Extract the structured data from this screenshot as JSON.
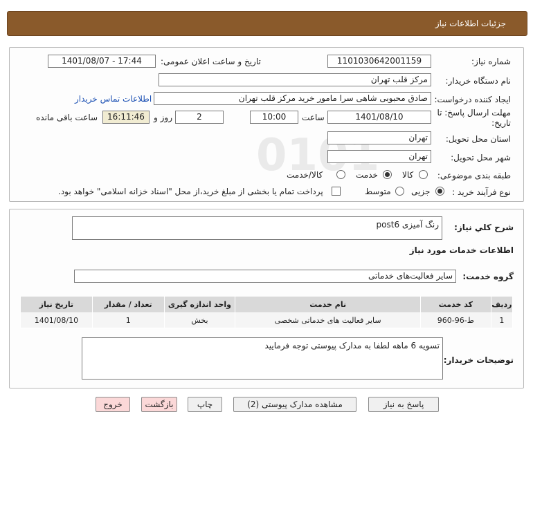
{
  "header": {
    "title": "جزئیات اطلاعات نیاز"
  },
  "form": {
    "need_number_label": "شماره نیاز:",
    "need_number": "1101030642001159",
    "announce_label": "تاریخ و ساعت اعلان عمومی:",
    "announce_value": "1401/08/07 - 17:44",
    "buyer_org_label": "نام دستگاه خریدار:",
    "buyer_org": "مرکز قلب تهران",
    "requester_label": "ایجاد کننده درخواست:",
    "requester": "صادق محبوبی شاهی سرا مامور خرید مرکز قلب تهران",
    "contact_link": "اطلاعات تماس خریدار",
    "deadline_label": "مهلت ارسال پاسخ: تا تاریخ:",
    "deadline_date": "1401/08/10",
    "time_label": "ساعت",
    "deadline_time": "10:00",
    "days_value": "2",
    "days_label": "روز و",
    "remaining_time": "16:11:46",
    "remaining_label": "ساعت باقی مانده",
    "province_label": "استان محل تحویل:",
    "province": "تهران",
    "city_label": "شهر محل تحویل:",
    "city": "تهران",
    "category_label": "طبقه بندی موضوعی:",
    "category_options": [
      "کالا",
      "خدمت",
      "کالا/خدمت"
    ],
    "category_selected": "خدمت",
    "purchase_type_label": "نوع فرآیند خرید :",
    "purchase_options": [
      "جزیی",
      "متوسط"
    ],
    "purchase_selected": "جزیی",
    "treasury_note": "پرداخت تمام یا بخشی از مبلغ خرید،از محل \"اسناد خزانه اسلامی\" خواهد بود."
  },
  "details": {
    "summary_label": "شرح کلي نياز:",
    "summary": "رنگ آمیزی post6",
    "services_heading": "اطلاعات خدمات مورد نیاز",
    "service_group_label": "گروه خدمت:",
    "service_group": "سایر فعالیت‌های خدماتی",
    "table": {
      "headers": [
        "ردیف",
        "کد خدمت",
        "نام خدمت",
        "واحد اندازه گیری",
        "تعداد / مقدار",
        "تاریخ نیاز"
      ],
      "rows": [
        [
          "1",
          "ط-96-960",
          "سایر فعالیت های خدماتی شخصی",
          "بخش",
          "1",
          "1401/08/10"
        ]
      ]
    },
    "buyer_notes_label": "توضیحات خریدار:",
    "buyer_notes": "تسویه 6 ماهه لطفا به مدارک پیوستی توجه فرمایید"
  },
  "buttons": {
    "reply": "پاسخ به نیاز",
    "attachments": "مشاهده مدارک پیوستی (2)",
    "print": "چاپ",
    "back": "بازگشت",
    "exit": "خروج"
  }
}
